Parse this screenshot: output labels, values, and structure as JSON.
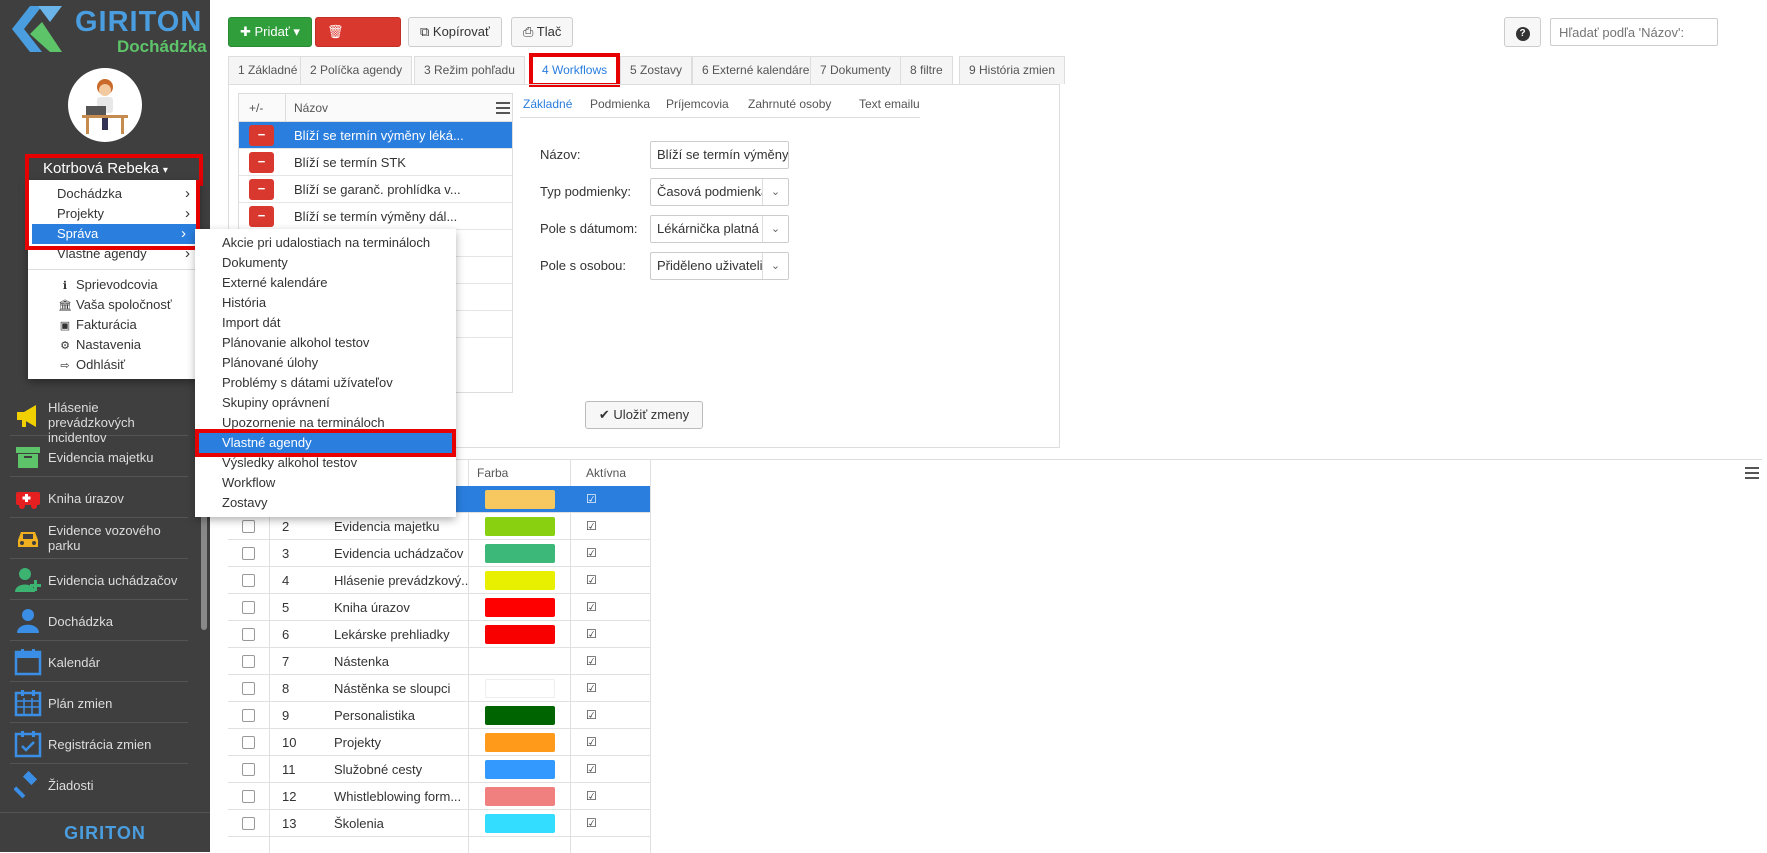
{
  "brand": {
    "name": "GIRITON",
    "subtitle": "Dochádzka",
    "footer": "GIRITON"
  },
  "user": {
    "name": "Kotrbová Rebeka"
  },
  "user_menu": {
    "items": [
      {
        "label": "Dochádzka",
        "arrow": true
      },
      {
        "label": "Projekty",
        "arrow": true
      },
      {
        "label": "Správa",
        "arrow": true,
        "selected": true
      },
      {
        "label": "Vlastné agendy",
        "arrow": true
      }
    ],
    "items2": [
      {
        "label": "Sprievodcovia",
        "icon": "info-icon",
        "glyph": "ℹ"
      },
      {
        "label": "Vaša spoločnosť",
        "icon": "bank-icon",
        "glyph": "🏛"
      },
      {
        "label": "Fakturácia",
        "icon": "money-icon",
        "glyph": "▣"
      },
      {
        "label": "Nastavenia",
        "icon": "gear-icon",
        "glyph": "⚙"
      },
      {
        "label": "Odhlásiť",
        "icon": "logout-icon",
        "glyph": "⇨"
      }
    ]
  },
  "submenu": {
    "items": [
      "Akcie pri udalostiach na termináloch",
      "Dokumenty",
      "Externé kalendáre",
      "História",
      "Import dát",
      "Plánovanie alkohol testov",
      "Plánované úlohy",
      "Problémy s dátami užívateľov",
      "Skupiny oprávnení",
      "Upozornenie na termináloch",
      "Vlastné agendy",
      "Výsledky alkohol testov",
      "Workflow",
      "Zostavy"
    ],
    "selected_index": 10
  },
  "nav": [
    {
      "label": "Hlásenie prevádzkových incidentov",
      "icon": "megaphone-icon",
      "color": "#f0d000"
    },
    {
      "label": "Evidencia majetku",
      "icon": "box-icon",
      "color": "#5ec46a"
    },
    {
      "label": "Kniha úrazov",
      "icon": "ambulance-icon",
      "color": "#e62020"
    },
    {
      "label": "Evidence vozového parku",
      "icon": "car-icon",
      "color": "#f0b020"
    },
    {
      "label": "Evidencia uchádzačov",
      "icon": "user-plus-icon",
      "color": "#3cb371"
    },
    {
      "label": "Dochádzka",
      "icon": "user-icon",
      "color": "#3a8ee6"
    },
    {
      "label": "Kalendár",
      "icon": "calendar-icon",
      "color": "#3a8ee6"
    },
    {
      "label": "Plán zmien",
      "icon": "grid-calendar-icon",
      "color": "#3a8ee6"
    },
    {
      "label": "Registrácia zmien",
      "icon": "calendar-check-icon",
      "color": "#3a8ee6"
    },
    {
      "label": "Žiadosti",
      "icon": "gavel-icon",
      "color": "#3a8ee6"
    }
  ],
  "toolbar": {
    "add": "Pridať",
    "delete": "Zmazať",
    "copy": "Kopírovať",
    "print": "Tlač",
    "help": "?",
    "search_placeholder": "Hľadať podľa 'Názov':"
  },
  "tabs": [
    "1 Základné",
    "2 Políčka agendy",
    "3 Režim pohľadu",
    "4 Workflows",
    "5 Zostavy",
    "6 Externé kalendáre",
    "7 Dokumenty",
    "8 filtre",
    "9 História zmien"
  ],
  "active_tab": 3,
  "workflow_table": {
    "col1": "+/-",
    "col2": "Názov",
    "rows": [
      "Blíží se termín výměny léká...",
      "Blíží se termín STK",
      "Blíží se garanč. prohlídka v...",
      "Blíží se termín výměny dál..."
    ]
  },
  "subtabs": [
    "Základné",
    "Podmienka",
    "Príjemcovia",
    "Zahrnuté osoby",
    "Text emailu"
  ],
  "form": {
    "name_label": "Názov:",
    "name_value": "Blíží se termín výměny",
    "cond_label": "Typ podmienky:",
    "cond_value": "Časová podmienka",
    "date_label": "Pole s dátumom:",
    "date_value": "Lékárnička platná",
    "person_label": "Pole s osobou:",
    "person_value": "Přiděleno uživateli",
    "save": "Uložiť zmeny"
  },
  "grid": {
    "headers": {
      "color": "Farba",
      "active": "Aktívna"
    },
    "rows": [
      {
        "n": "",
        "name": "",
        "color": "#f8c860",
        "selected": true
      },
      {
        "n": "2",
        "name": "Evidencia majetku",
        "color": "#88d010"
      },
      {
        "n": "3",
        "name": "Evidencia uchádzačov",
        "color": "#3cb878"
      },
      {
        "n": "4",
        "name": "Hlásenie prevádzkový...",
        "color": "#e8f000"
      },
      {
        "n": "5",
        "name": "Kniha úrazov",
        "color": "#ff0000"
      },
      {
        "n": "6",
        "name": "Lekárske prehliadky",
        "color": "#f80000"
      },
      {
        "n": "7",
        "name": "Nástenka",
        "color": ""
      },
      {
        "n": "8",
        "name": "Nástěnka se sloupci",
        "color": "#ffffff"
      },
      {
        "n": "9",
        "name": "Personalistika",
        "color": "#006400"
      },
      {
        "n": "10",
        "name": "Projekty",
        "color": "#ff9a1a"
      },
      {
        "n": "11",
        "name": "Služobné cesty",
        "color": "#3399ff"
      },
      {
        "n": "12",
        "name": "Whistleblowing form...",
        "color": "#f08080"
      },
      {
        "n": "13",
        "name": "Školenia",
        "color": "#33ddff"
      }
    ]
  }
}
